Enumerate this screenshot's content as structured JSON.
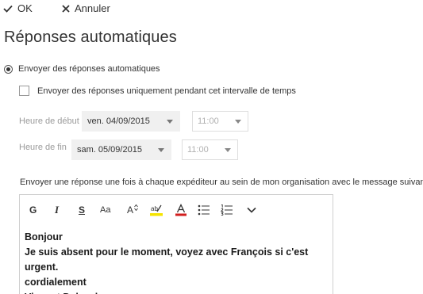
{
  "command_bar": {
    "ok_label": "OK",
    "cancel_label": "Annuler"
  },
  "page": {
    "title": "Réponses automatiques"
  },
  "auto_reply": {
    "radio_label": "Envoyer des réponses automatiques",
    "radio_checked": true,
    "time_range_label": "Envoyer des réponses uniquement pendant cet intervalle de temps",
    "time_range_checked": false
  },
  "schedule": {
    "start_label": "Heure de début",
    "start_date": "ven. 04/09/2015",
    "start_time": "11:00",
    "end_label": "Heure de fin",
    "end_date": "sam. 05/09/2015",
    "end_time": "11:00"
  },
  "internal_message": {
    "label": "Envoyer une réponse une fois à chaque expéditeur au sein de mon organisation avec le message suivant :",
    "toolbar": {
      "bold": "G",
      "italic": "I",
      "underline": "S",
      "font_size": "Aa",
      "grow_font": "A",
      "highlight_icon": "highlight-icon",
      "font_color_icon": "font-color-icon",
      "bullets_icon": "bullets-icon",
      "numbering_icon": "numbering-icon",
      "more_icon": "chevron-down-icon"
    },
    "body_lines": [
      "Bonjour",
      "Je suis absent pour le moment, voyez avec François si c'est",
      "urgent.",
      "cordialement",
      "Vincent Delaval"
    ]
  },
  "colors": {
    "highlight": "#f5e400",
    "font_color": "#d11e1e",
    "field_bg": "#f0f0f0",
    "disabled_text": "#9a9a9a"
  }
}
